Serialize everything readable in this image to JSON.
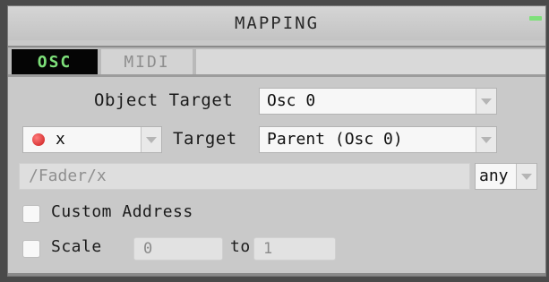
{
  "window": {
    "title": "MAPPING"
  },
  "tabs": [
    {
      "label": "OSC",
      "active": true
    },
    {
      "label": "MIDI",
      "active": false
    }
  ],
  "object_target": {
    "label": "Object Target",
    "value": "Osc 0"
  },
  "source": {
    "value": "x",
    "indicator_color": "#d42a2a"
  },
  "target": {
    "label": "Target",
    "value": "Parent (Osc 0)"
  },
  "address": {
    "value": "/Fader/x"
  },
  "address_type": {
    "value": "any"
  },
  "custom_address": {
    "label": "Custom Address",
    "checked": false
  },
  "scale": {
    "label": "Scale",
    "checked": false,
    "from": "0",
    "to_label": "to",
    "to": "1"
  },
  "colors": {
    "accent": "#7ee07a",
    "panel": "#c9c9c9",
    "active_tab_bg": "#050505"
  }
}
